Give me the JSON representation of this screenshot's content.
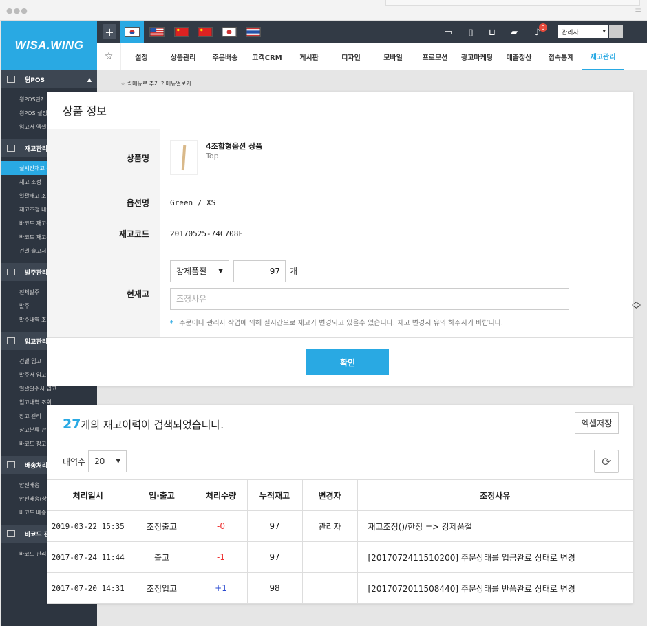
{
  "brand": {
    "logo": "WISA.WING"
  },
  "topbar": {
    "badge_count": "9",
    "admin_label": "관리자"
  },
  "menu": {
    "items": [
      "설정",
      "상품관리",
      "주문배송",
      "고객CRM",
      "게시판",
      "디자인",
      "모바일",
      "프로모션",
      "광고마케팅",
      "매출정산",
      "접속통계",
      "재고관리"
    ],
    "active": "재고관리"
  },
  "sidebar": {
    "sections": [
      {
        "title": "윙POS",
        "items": [
          "윙POS란?",
          "윙POS 설정",
          "입고서 엑셀업"
        ]
      },
      {
        "title": "재고관리",
        "items": [
          "실시간재고 관",
          "재고 조정",
          "일괄재고 조정",
          "재고조정 내역",
          "바코드 재고관",
          "바코드 재고관",
          "건별 출고처리"
        ]
      },
      {
        "title": "발주관리",
        "items": [
          "전체발주",
          "발주",
          "발주내역 조회"
        ]
      },
      {
        "title": "입고관리",
        "items": [
          "건별 입고",
          "발주서 입고",
          "일괄발주서 입고",
          "입고내역 조회",
          "창고 관리",
          "창고분류 관리",
          "바코드 창고 이"
        ]
      },
      {
        "title": "배송처리",
        "items": [
          "안전배송",
          "안전배송(상",
          "바코드 배송처"
        ]
      },
      {
        "title": "바코드 관",
        "items": [
          "바코드 관리"
        ]
      }
    ]
  },
  "quick": {
    "add": "퀵메뉴로 추가",
    "manual": "매뉴얼보기"
  },
  "modal": {
    "title": "상품 정보",
    "product_label": "상품명",
    "product_name": "4조합형옵션 상품",
    "product_sub": "Top",
    "option_label": "옵션명",
    "option_value": "Green / XS",
    "code_label": "재고코드",
    "code_value": "20170525-74C708F",
    "stock_label": "현재고",
    "stock_mode": "강제품절",
    "stock_qty": "97",
    "unit": "개",
    "reason_placeholder": "조정사유",
    "note": "주문이나 관리자 작업에 의해 실시간으로 재고가 변경되고 있을수 있습니다. 재고 변경시 유의 해주시기 바랍니다.",
    "confirm": "확인"
  },
  "history": {
    "count": "27",
    "title_suffix": "개의 재고이력이 검색되었습니다.",
    "excel": "엑셀저장",
    "rows_label": "내역수",
    "rows_value": "20",
    "headers": [
      "처리일시",
      "입·출고",
      "처리수량",
      "누적재고",
      "변경자",
      "조정사유"
    ],
    "rows": [
      [
        "2019-03-22 15:35",
        "조정출고",
        "-0",
        "97",
        "관리자",
        "재고조정()/한정 => 강제품절"
      ],
      [
        "2017-07-24 11:44",
        "출고",
        "-1",
        "97",
        "",
        "[2017072411510200] 주문상태를 입금완료 상태로 변경"
      ],
      [
        "2017-07-20 14:31",
        "조정입고",
        "+1",
        "98",
        "",
        "[2017072011508440] 주문상태를 반품완료 상태로 변경"
      ]
    ]
  }
}
